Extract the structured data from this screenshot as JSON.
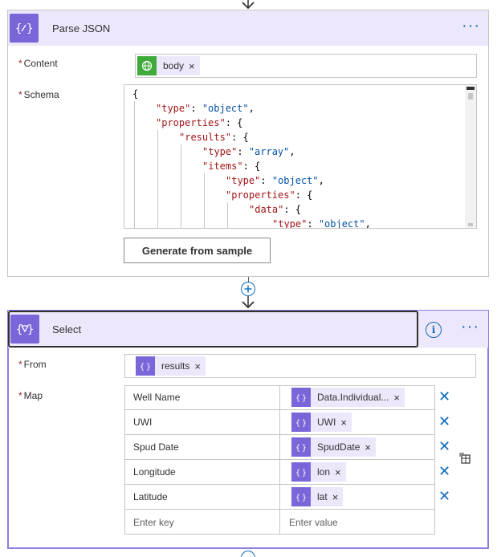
{
  "colors": {
    "accent": "#0f6cbd",
    "action_icon": "#7b66d9",
    "header_bg": "#ede7fb",
    "token_green": "#3eab3a",
    "required": "#a4262c"
  },
  "parse_json": {
    "title": "Parse JSON",
    "icon": "braces-icon",
    "content": {
      "label": "Content",
      "token": {
        "label": "body",
        "icon": "globe-icon"
      }
    },
    "schema": {
      "label": "Schema",
      "lines": [
        {
          "indent": 0,
          "key": "",
          "value": "",
          "text": "{"
        },
        {
          "indent": 1,
          "key": "\"type\"",
          "value": "\"object\"",
          "tail": ","
        },
        {
          "indent": 1,
          "key": "\"properties\"",
          "value": "",
          "tail": ": {"
        },
        {
          "indent": 2,
          "key": "\"results\"",
          "value": "",
          "tail": ": {"
        },
        {
          "indent": 3,
          "key": "\"type\"",
          "value": "\"array\"",
          "tail": ","
        },
        {
          "indent": 3,
          "key": "\"items\"",
          "value": "",
          "tail": ": {"
        },
        {
          "indent": 4,
          "key": "\"type\"",
          "value": "\"object\"",
          "tail": ","
        },
        {
          "indent": 4,
          "key": "\"properties\"",
          "value": "",
          "tail": ": {"
        },
        {
          "indent": 5,
          "key": "\"data\"",
          "value": "",
          "tail": ": {"
        },
        {
          "indent": 6,
          "key": "\"type\"",
          "value": "\"object\"",
          "tail": ","
        }
      ]
    },
    "generate_button": "Generate from sample"
  },
  "select": {
    "title": "Select",
    "icon": "select-funnel-icon",
    "from": {
      "label": "From",
      "token": {
        "label": "results",
        "icon": "braces-icon"
      }
    },
    "map": {
      "label": "Map",
      "rows": [
        {
          "key": "Well Name",
          "value": "Data.Individual..."
        },
        {
          "key": "UWI",
          "value": "UWI"
        },
        {
          "key": "Spud Date",
          "value": "SpudDate"
        },
        {
          "key": "Longitude",
          "value": "lon"
        },
        {
          "key": "Latitude",
          "value": "lat"
        }
      ],
      "key_placeholder": "Enter key",
      "value_placeholder": "Enter value"
    }
  }
}
